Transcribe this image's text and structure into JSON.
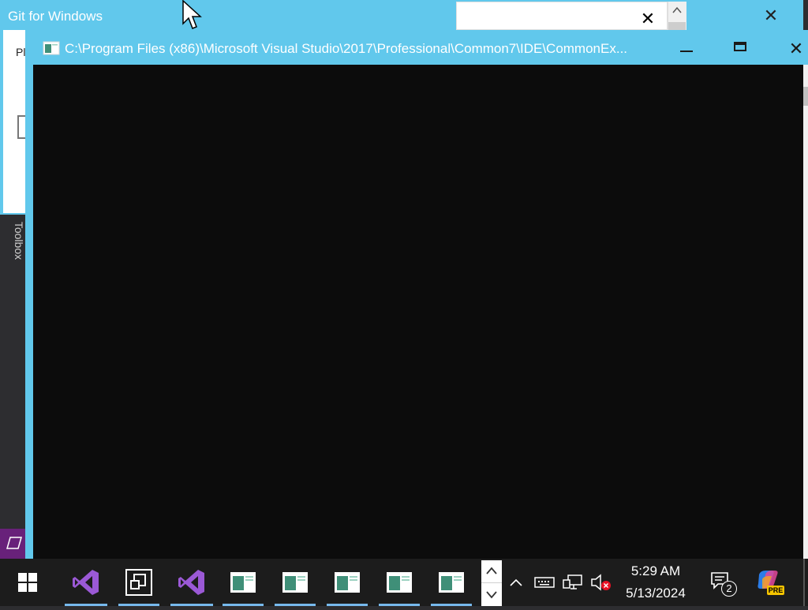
{
  "background_app": {
    "toolbox_label": "Toolbox"
  },
  "git_window": {
    "title": "Git for Windows",
    "inner_label": "Pl",
    "close_glyph": "✕",
    "box_close_glyph": "✕"
  },
  "console_window": {
    "title": "C:\\Program Files (x86)\\Microsoft Visual Studio\\2017\\Professional\\Common7\\IDE\\CommonEx...",
    "close_glyph": "✕"
  },
  "taskbar": {
    "items": [
      {
        "name": "start",
        "icon": "windows-logo-icon"
      },
      {
        "name": "visual-studio-1",
        "icon": "visual-studio-icon"
      },
      {
        "name": "task-view-app",
        "icon": "task-view-icon"
      },
      {
        "name": "visual-studio-2",
        "icon": "visual-studio-icon"
      },
      {
        "name": "console-window-1",
        "icon": "console-window-icon"
      },
      {
        "name": "console-window-2",
        "icon": "console-window-icon"
      },
      {
        "name": "console-window-3",
        "icon": "console-window-icon"
      },
      {
        "name": "console-window-4",
        "icon": "console-window-icon"
      },
      {
        "name": "console-window-5",
        "icon": "console-window-icon"
      }
    ],
    "tray": {
      "notification_count": "2",
      "copilot_badge": "PRE"
    },
    "clock": {
      "time": "5:29 AM",
      "date": "5/13/2024"
    }
  },
  "colors": {
    "window_accent": "#61c8ec",
    "console_bg": "#0c0c0c",
    "taskbar_bg": "#1c1c1c",
    "vs_purple": "#68217a",
    "active_underline": "#76b9ed"
  }
}
